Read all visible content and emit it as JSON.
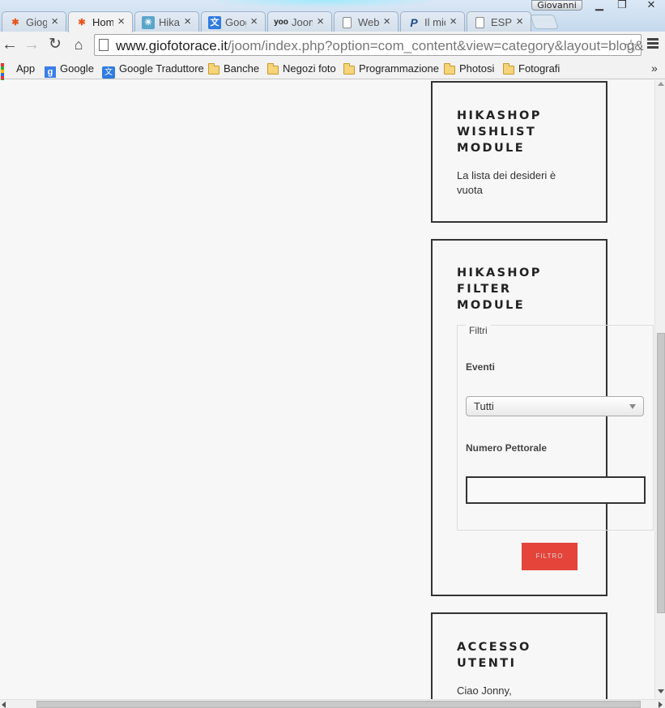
{
  "browser": {
    "profile_name": "Giovanni",
    "tabs": [
      {
        "label": "Giogi",
        "icon": "joomla-icon"
      },
      {
        "label": "Hom",
        "icon": "joomla-icon",
        "active": true
      },
      {
        "label": "Hika",
        "icon": "hikashop-icon"
      },
      {
        "label": "Goog",
        "icon": "google-translate-icon"
      },
      {
        "label": "Joom",
        "icon": "yootheme-icon"
      },
      {
        "label": "Web",
        "icon": "page-icon"
      },
      {
        "label": "Il mio",
        "icon": "paypal-icon"
      },
      {
        "label": "ESP",
        "icon": "page-icon"
      }
    ],
    "url_host": "www.giofotorace.it",
    "url_rest": "/joom/index.php?option=com_content&view=category&layout=blog&",
    "bookmarks": [
      {
        "label": "App",
        "icon": "apps-grid-icon"
      },
      {
        "label": "Google",
        "icon": "google-icon"
      },
      {
        "label": "Google Traduttore",
        "icon": "google-translate-icon"
      },
      {
        "label": "Banche",
        "icon": "folder-icon"
      },
      {
        "label": "Negozi foto",
        "icon": "folder-icon"
      },
      {
        "label": "Programmazione",
        "icon": "folder-icon"
      },
      {
        "label": "Photosi",
        "icon": "folder-icon"
      },
      {
        "label": "Fotografi",
        "icon": "folder-icon"
      }
    ],
    "more_bookmarks": "»"
  },
  "page": {
    "wishlist": {
      "title": "HIKASHOP\nWISHLIST\nMODULE",
      "text": "La lista dei desideri è vuota"
    },
    "filter": {
      "title": "HIKASHOP\nFILTER\nMODULE",
      "legend": "Filtri",
      "events_label": "Eventi",
      "events_selected": "Tutti",
      "bib_label": "Numero Pettorale",
      "bib_value": "",
      "button_label": "FILTRO"
    },
    "login": {
      "title": "ACCESSO\nUTENTI",
      "greeting": "Ciao Jonny,"
    }
  },
  "colors": {
    "filter_button": "#e4443a",
    "module_border": "#333333"
  }
}
